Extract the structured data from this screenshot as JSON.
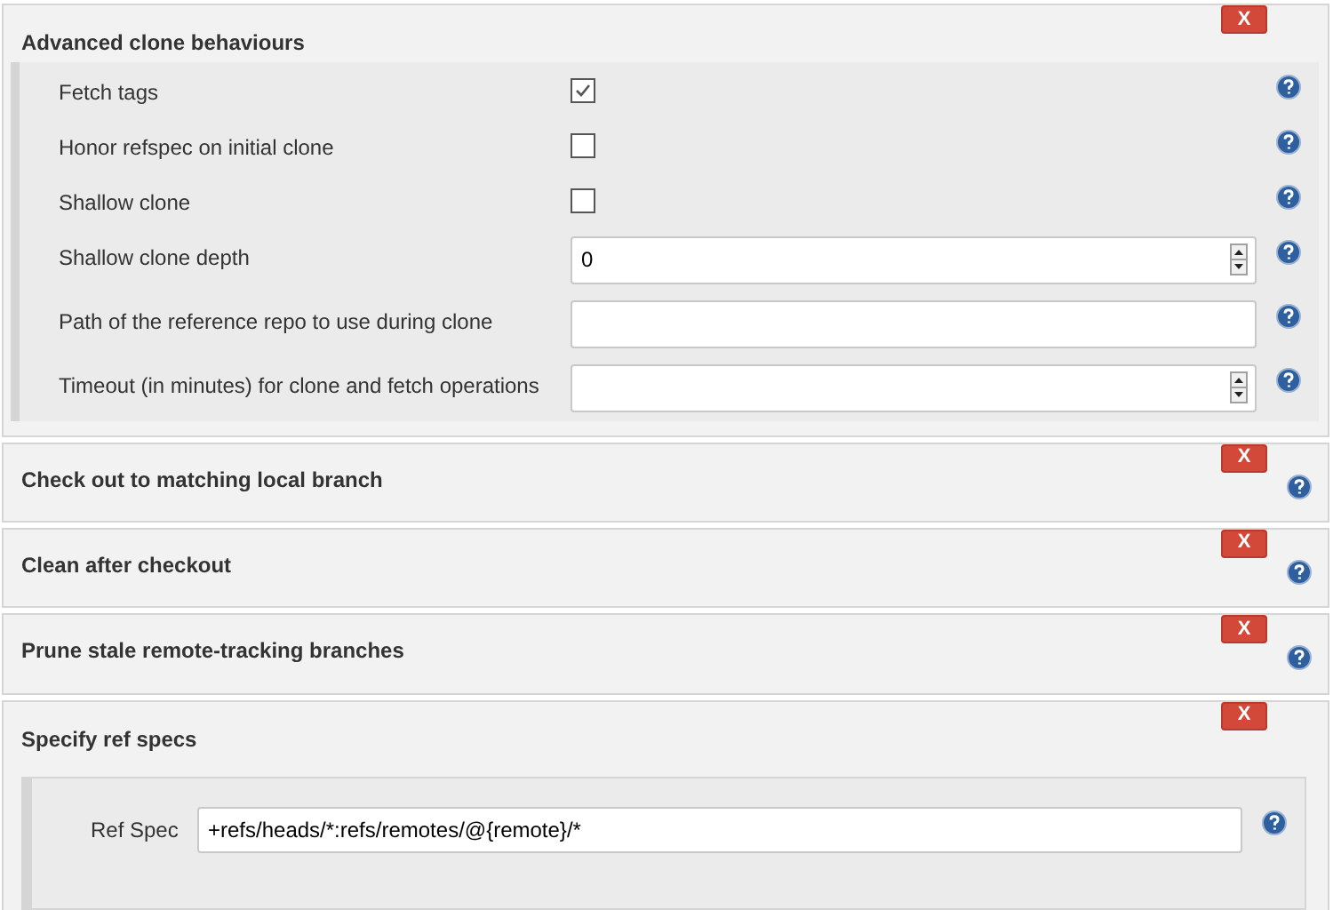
{
  "sections": [
    {
      "title": "Advanced clone behaviours",
      "delete_label": "X",
      "has_help": false,
      "kind": "list",
      "fields": [
        {
          "kind": "checkbox",
          "label": "Fetch tags",
          "checked": true
        },
        {
          "kind": "checkbox",
          "label": "Honor refspec on initial clone",
          "checked": false
        },
        {
          "kind": "checkbox",
          "label": "Shallow clone",
          "checked": false
        },
        {
          "kind": "number",
          "label": "Shallow clone depth",
          "value": "0"
        },
        {
          "kind": "text",
          "label": "Path of the reference repo to use during clone"
        },
        {
          "kind": "number",
          "label": "Timeout (in minutes) for clone and fetch operations"
        }
      ]
    },
    {
      "title": "Check out to matching local branch",
      "delete_label": "X",
      "has_help": true,
      "kind": "plain"
    },
    {
      "title": "Clean after checkout",
      "delete_label": "X",
      "has_help": true,
      "kind": "plain"
    },
    {
      "title": "Prune stale remote-tracking branches",
      "delete_label": "X",
      "has_help": true,
      "kind": "plain"
    },
    {
      "title": "Specify ref specs",
      "delete_label": "X",
      "has_help": false,
      "kind": "boxed",
      "fields": [
        {
          "kind": "text",
          "label": "Ref Spec",
          "value": "+refs/heads/*:refs/remotes/@{remote}/*"
        }
      ]
    }
  ]
}
